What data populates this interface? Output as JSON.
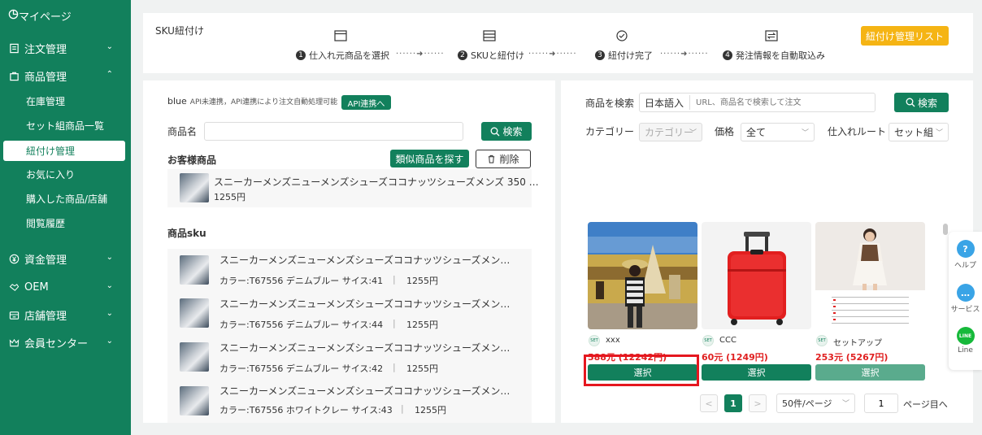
{
  "sidebar": {
    "mypage": "マイページ",
    "menus": [
      {
        "label": "注文管理",
        "chev": "⌄"
      },
      {
        "label": "商品管理",
        "chev": "⌃"
      },
      {
        "label": "資金管理",
        "chev": "⌄"
      },
      {
        "label": "OEM",
        "chev": "⌄"
      },
      {
        "label": "店舗管理",
        "chev": "⌄"
      },
      {
        "label": "会員センター",
        "chev": "⌄"
      }
    ],
    "subs": [
      "在庫管理",
      "セット組商品一覧",
      "紐付け管理",
      "お気に入り",
      "購入した商品/店舗",
      "閲覧履歴"
    ]
  },
  "top": {
    "title": "SKU紐付け",
    "steps": [
      {
        "num": "1",
        "label": "仕入れ元商品を選択"
      },
      {
        "num": "2",
        "label": "SKUと紐付け"
      },
      {
        "num": "3",
        "label": "紐付け完了"
      },
      {
        "num": "4",
        "label": "発注情報を自動取込み"
      }
    ],
    "dots": "······➜······",
    "list_button": "紐付け管理リスト"
  },
  "left": {
    "api_name": "blue",
    "api_status": "API未連携，API連携により注文自動処理可能",
    "api_button": "API連携へ",
    "product_name_label": "商品名",
    "product_name_value": "",
    "search_button": "検索",
    "customer_product_label": "お客様商品",
    "find_similar_button": "類似商品を探す",
    "delete_button": "削除",
    "customer_product": {
      "title": "スニーカーメンズニューメンズシューズココナッツシューズメンズ 350 …",
      "price": "1255円"
    },
    "sku_label": "商品sku",
    "skus": [
      {
        "title": "スニーカーメンズニューメンズシューズココナッツシューズメン…",
        "detail": "カラー:T67556 デニムブルー サイス:41",
        "sep": "|",
        "price": "1255円"
      },
      {
        "title": "スニーカーメンズニューメンズシューズココナッツシューズメン…",
        "detail": "カラー:T67556 デニムブルー サイス:44",
        "sep": "|",
        "price": "1255円"
      },
      {
        "title": "スニーカーメンズニューメンズシューズココナッツシューズメン…",
        "detail": "カラー:T67556 デニムブルー サイス:42",
        "sep": "|",
        "price": "1255円"
      },
      {
        "title": "スニーカーメンズニューメンズシューズココナッツシューズメン…",
        "detail": "カラー:T67556 ホワイトクレー サイス:43",
        "sep": "|",
        "price": "1255円"
      }
    ]
  },
  "right": {
    "search_label": "商品を検索",
    "lang_select": "日本語入",
    "search_placeholder": "URL、商品名で検索して注文",
    "search_button": "検索",
    "category_label": "カテゴリー",
    "category_select": "カテゴリー",
    "price_label": "価格",
    "price_select": "全て",
    "route_label": "仕入れルート",
    "route_select": "セット組",
    "cards": [
      {
        "badge": "SET",
        "name": "xxx",
        "price": "588元 (12242円)",
        "button": "選択",
        "color": "#12805c"
      },
      {
        "badge": "SET",
        "name": "CCC",
        "price": "60元 (1249円)",
        "button": "選択",
        "color": "#12805c"
      },
      {
        "badge": "SET",
        "name": "セットアップ",
        "price": "253元 (5267円)",
        "button": "選択",
        "color": "#5aab8d"
      }
    ],
    "pagination": {
      "prev": "<",
      "current": "1",
      "next": ">",
      "per_page": "50件/ページ",
      "goto_value": "1",
      "goto_label": "ページ目へ"
    }
  },
  "float": {
    "help": "ヘルプ",
    "service": "サービス",
    "line": "Line"
  },
  "colors": {
    "primary": "#12805c",
    "accent": "#f5b414",
    "highlight": "#e5171f",
    "price": "#e02020"
  }
}
